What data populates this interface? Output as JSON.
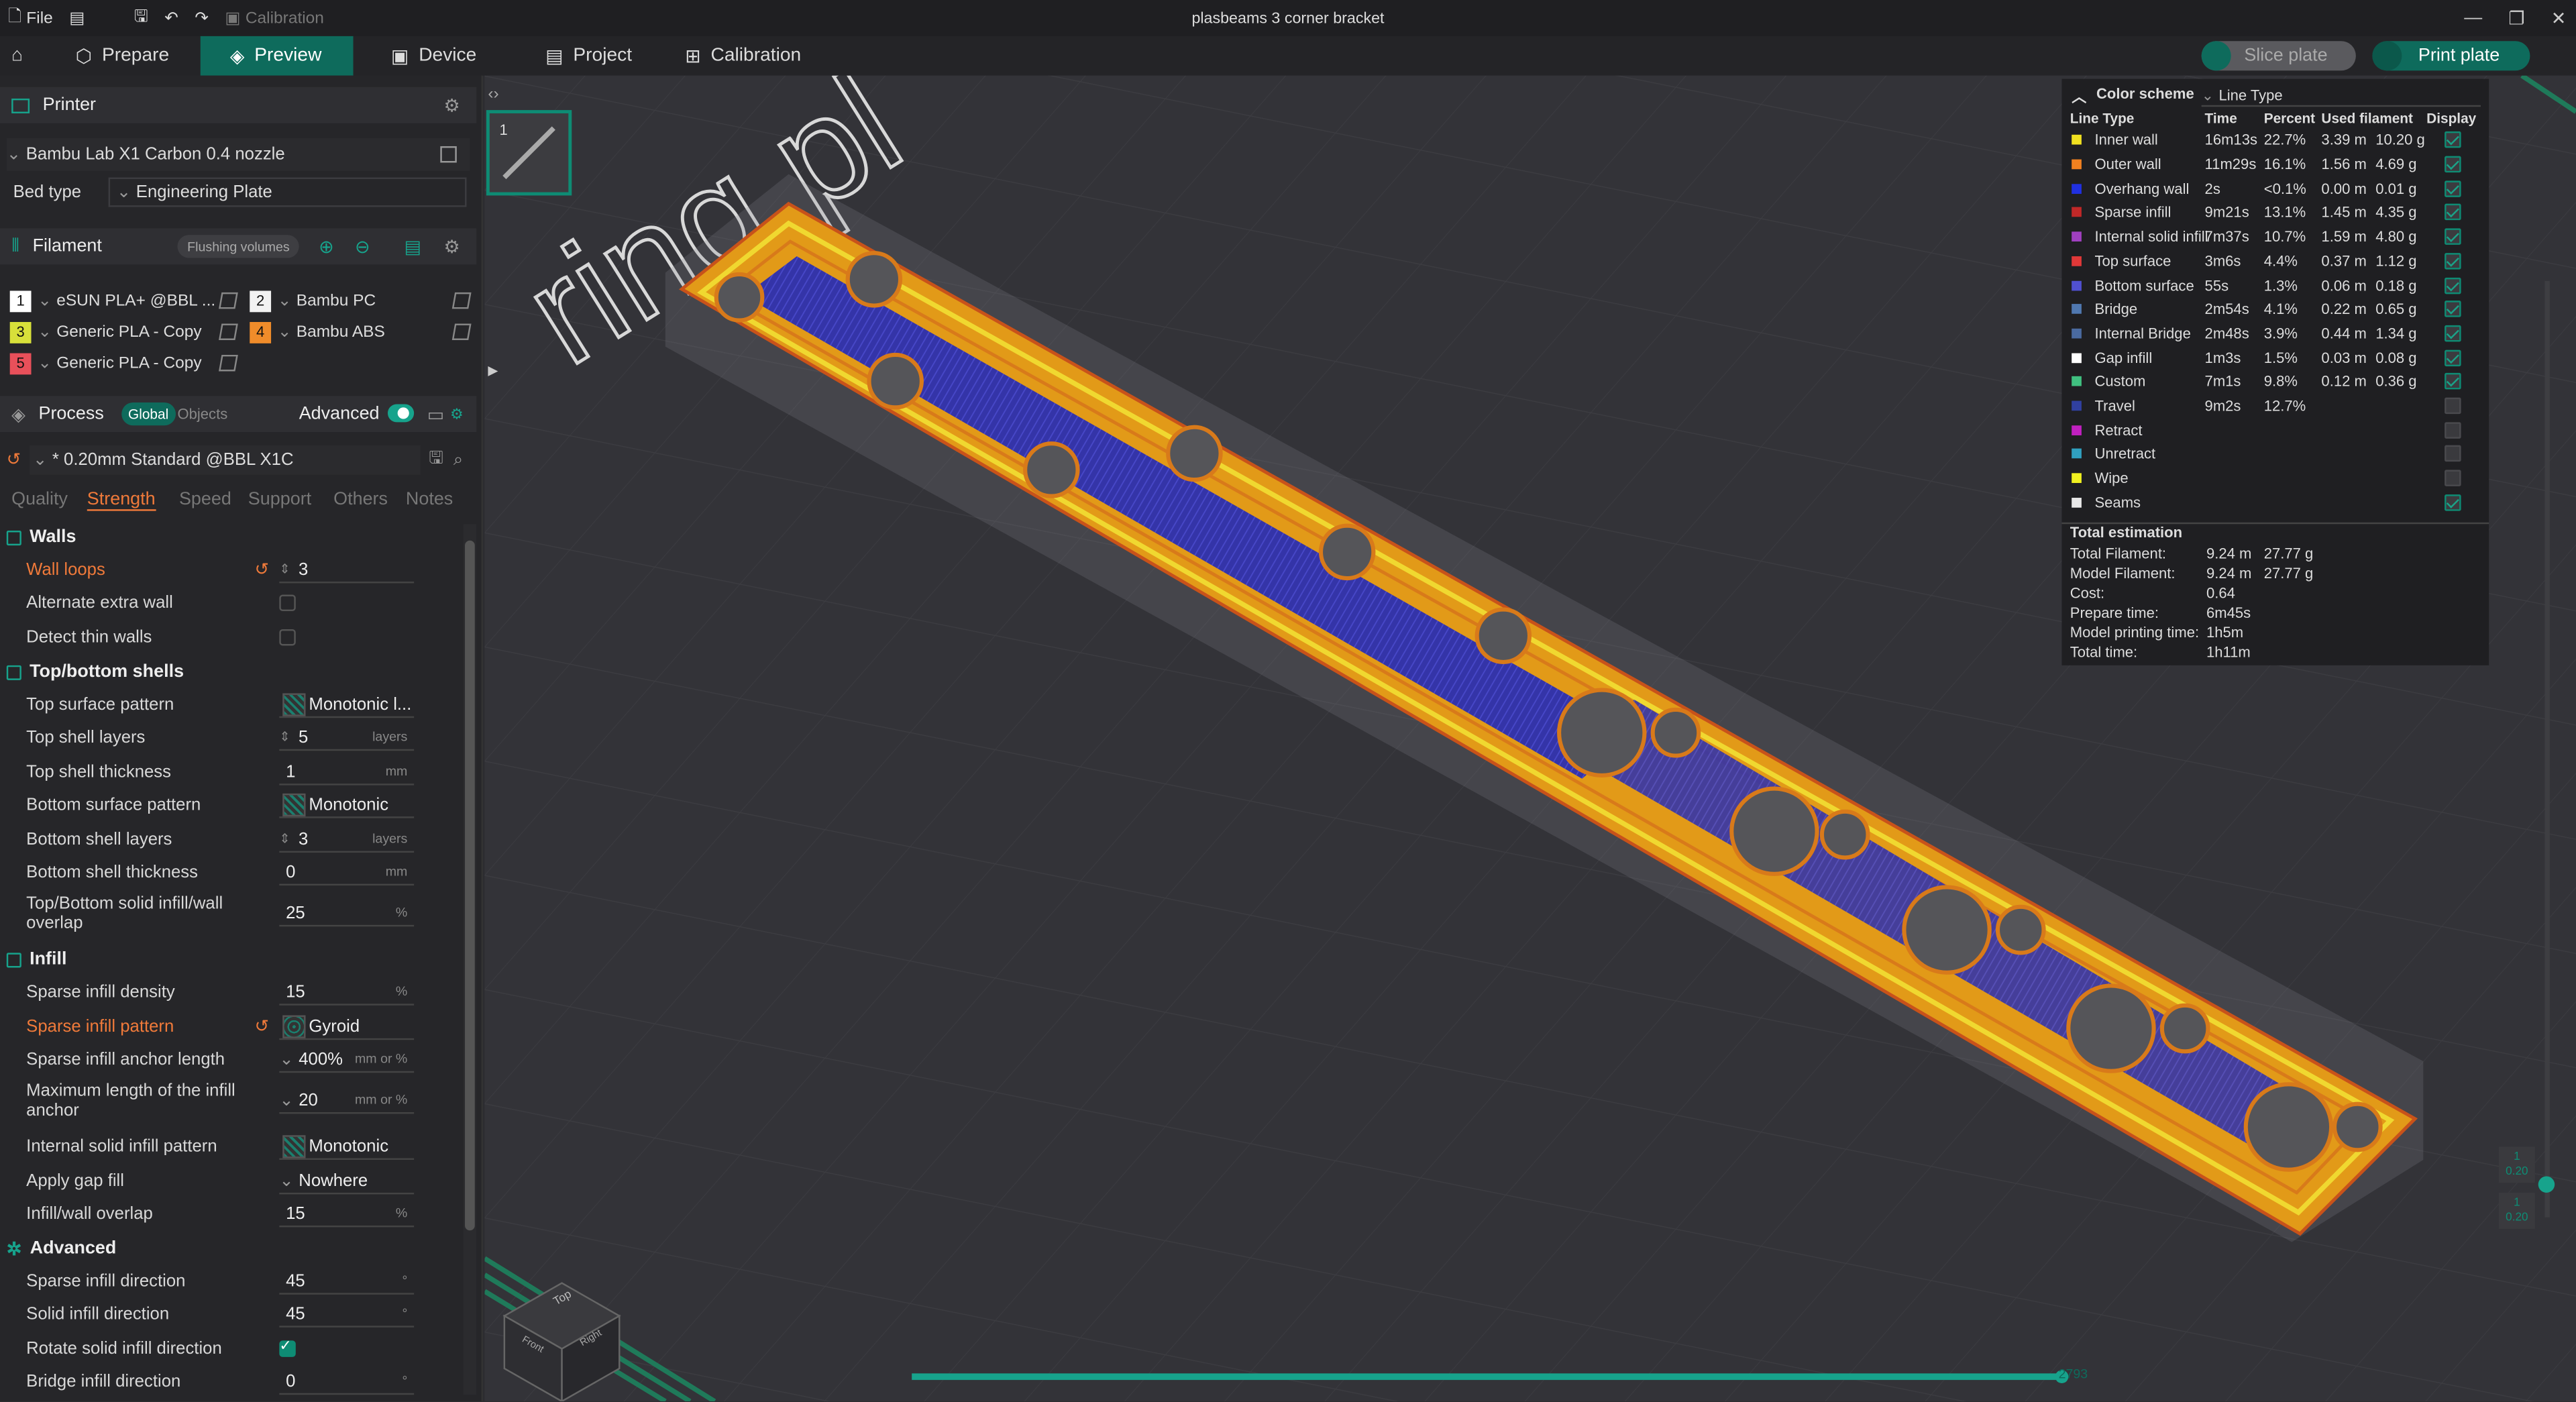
{
  "titlebar": {
    "file_label": "File",
    "calibration_label": "Calibration",
    "window_title": "plasbeams 3 corner bracket"
  },
  "tabs": {
    "prepare": "Prepare",
    "preview": "Preview",
    "device": "Device",
    "project": "Project",
    "calibration": "Calibration"
  },
  "actions": {
    "slice_plate": "Slice plate",
    "print_plate": "Print plate"
  },
  "printer": {
    "section_title": "Printer",
    "name": "Bambu Lab X1 Carbon 0.4 nozzle",
    "bed_type_label": "Bed type",
    "bed_type": "Engineering Plate"
  },
  "filament": {
    "section_title": "Filament",
    "flushing_label": "Flushing volumes",
    "slots": [
      {
        "num": "1",
        "name": "eSUN PLA+ @BBL ...",
        "color": "#ffffff"
      },
      {
        "num": "2",
        "name": "Bambu PC",
        "color": "#f2f2f2"
      },
      {
        "num": "3",
        "name": "Generic PLA - Copy",
        "color": "#d8e03a"
      },
      {
        "num": "4",
        "name": "Bambu ABS",
        "color": "#f08c2a"
      },
      {
        "num": "5",
        "name": "Generic PLA - Copy",
        "color": "#e8505a"
      }
    ]
  },
  "process": {
    "section_title": "Process",
    "global_label": "Global",
    "objects_label": "Objects",
    "advanced_label": "Advanced",
    "preset": "* 0.20mm Standard @BBL X1C",
    "subtabs": [
      "Quality",
      "Strength",
      "Speed",
      "Support",
      "Others",
      "Notes"
    ],
    "active_subtab": "Strength"
  },
  "settings": {
    "walls_group": "Walls",
    "wall_loops_label": "Wall loops",
    "wall_loops": "3",
    "alternate_extra_wall_label": "Alternate extra wall",
    "detect_thin_walls_label": "Detect thin walls",
    "topbottom_group": "Top/bottom shells",
    "top_surface_pattern_label": "Top surface pattern",
    "top_surface_pattern": "Monotonic l...",
    "top_shell_layers_label": "Top shell layers",
    "top_shell_layers": "5",
    "layers_unit": "layers",
    "top_shell_thickness_label": "Top shell thickness",
    "top_shell_thickness": "1",
    "mm_unit": "mm",
    "bottom_surface_pattern_label": "Bottom surface pattern",
    "bottom_surface_pattern": "Monotonic",
    "bottom_shell_layers_label": "Bottom shell layers",
    "bottom_shell_layers": "3",
    "bottom_shell_thickness_label": "Bottom shell thickness",
    "bottom_shell_thickness": "0",
    "tb_overlap_label_1": "Top/Bottom solid infill/wall",
    "tb_overlap_label_2": "overlap",
    "tb_overlap": "25",
    "percent_unit": "%",
    "infill_group": "Infill",
    "sparse_density_label": "Sparse infill density",
    "sparse_density": "15",
    "sparse_pattern_label": "Sparse infill pattern",
    "sparse_pattern": "Gyroid",
    "anchor_length_label": "Sparse infill anchor length",
    "anchor_length": "400%",
    "mm_or_pct_unit": "mm or %",
    "max_anchor_label_1": "Maximum length of the infill",
    "max_anchor_label_2": "anchor",
    "max_anchor": "20",
    "internal_solid_pattern_label": "Internal solid infill pattern",
    "internal_solid_pattern": "Monotonic",
    "gap_fill_label": "Apply gap fill",
    "gap_fill": "Nowhere",
    "infill_wall_overlap_label": "Infill/wall overlap",
    "infill_wall_overlap": "15",
    "advanced_group": "Advanced",
    "sparse_direction_label": "Sparse infill direction",
    "sparse_direction": "45",
    "deg_unit": "°",
    "solid_direction_label": "Solid infill direction",
    "solid_direction": "45",
    "rotate_solid_label": "Rotate solid infill direction",
    "bridge_direction_label": "Bridge infill direction",
    "bridge_direction": "0"
  },
  "viewport": {
    "plate_number": "1",
    "slider_value": "2793",
    "layer_top": "1",
    "layer_top_h": "0.20",
    "layer_bottom": "1",
    "layer_bottom_h": "0.20",
    "cube_top": "Top",
    "cube_front": "Front",
    "cube_right": "Right"
  },
  "legend": {
    "title": "Color scheme",
    "scheme": "Line Type",
    "headers": [
      "Line Type",
      "Time",
      "Percent",
      "Used filament",
      "Display"
    ],
    "rows": [
      {
        "name": "Inner wall",
        "color": "#f0e020",
        "time": "16m13s",
        "pct": "22.7%",
        "len": "3.39 m",
        "g": "10.20 g",
        "on": true
      },
      {
        "name": "Outer wall",
        "color": "#f08020",
        "time": "11m29s",
        "pct": "16.1%",
        "len": "1.56 m",
        "g": "4.69 g",
        "on": true
      },
      {
        "name": "Overhang wall",
        "color": "#2030e0",
        "time": "2s",
        "pct": "<0.1%",
        "len": "0.00 m",
        "g": "0.01 g",
        "on": true
      },
      {
        "name": "Sparse infill",
        "color": "#c02828",
        "time": "9m21s",
        "pct": "13.1%",
        "len": "1.45 m",
        "g": "4.35 g",
        "on": true
      },
      {
        "name": "Internal solid infill",
        "color": "#a040c0",
        "time": "7m37s",
        "pct": "10.7%",
        "len": "1.59 m",
        "g": "4.80 g",
        "on": true
      },
      {
        "name": "Top surface",
        "color": "#e03838",
        "time": "3m6s",
        "pct": "4.4%",
        "len": "0.37 m",
        "g": "1.12 g",
        "on": true
      },
      {
        "name": "Bottom surface",
        "color": "#5050d0",
        "time": "55s",
        "pct": "1.3%",
        "len": "0.06 m",
        "g": "0.18 g",
        "on": true
      },
      {
        "name": "Bridge",
        "color": "#5078b0",
        "time": "2m54s",
        "pct": "4.1%",
        "len": "0.22 m",
        "g": "0.65 g",
        "on": true
      },
      {
        "name": "Internal Bridge",
        "color": "#4a6aa0",
        "time": "2m48s",
        "pct": "3.9%",
        "len": "0.44 m",
        "g": "1.34 g",
        "on": true
      },
      {
        "name": "Gap infill",
        "color": "#ffffff",
        "time": "1m3s",
        "pct": "1.5%",
        "len": "0.03 m",
        "g": "0.08 g",
        "on": true
      },
      {
        "name": "Custom",
        "color": "#40c080",
        "time": "7m1s",
        "pct": "9.8%",
        "len": "0.12 m",
        "g": "0.36 g",
        "on": true
      },
      {
        "name": "Travel",
        "color": "#3040a0",
        "time": "9m2s",
        "pct": "12.7%",
        "len": "",
        "g": "",
        "on": false
      },
      {
        "name": "Retract",
        "color": "#c020c0",
        "time": "",
        "pct": "",
        "len": "",
        "g": "",
        "on": false
      },
      {
        "name": "Unretract",
        "color": "#30a0c0",
        "time": "",
        "pct": "",
        "len": "",
        "g": "",
        "on": false
      },
      {
        "name": "Wipe",
        "color": "#f0f020",
        "time": "",
        "pct": "",
        "len": "",
        "g": "",
        "on": false
      },
      {
        "name": "Seams",
        "color": "#e8e8e8",
        "time": "",
        "pct": "",
        "len": "",
        "g": "",
        "on": true
      }
    ],
    "total_title": "Total estimation",
    "totals": [
      {
        "label": "Total Filament:",
        "v1": "9.24 m",
        "v2": "27.77 g"
      },
      {
        "label": "Model Filament:",
        "v1": "9.24 m",
        "v2": "27.77 g"
      },
      {
        "label": "Cost:",
        "v1": "0.64",
        "v2": ""
      },
      {
        "label": "Prepare time:",
        "v1": "6m45s",
        "v2": ""
      },
      {
        "label": "Model printing time:",
        "v1": "1h5m",
        "v2": ""
      },
      {
        "label": "Total time:",
        "v1": "1h11m",
        "v2": ""
      }
    ]
  },
  "colors": {
    "accent": "#0e6b5c",
    "accent_bright": "#17a38c",
    "warning_label": "#f07a3a"
  }
}
